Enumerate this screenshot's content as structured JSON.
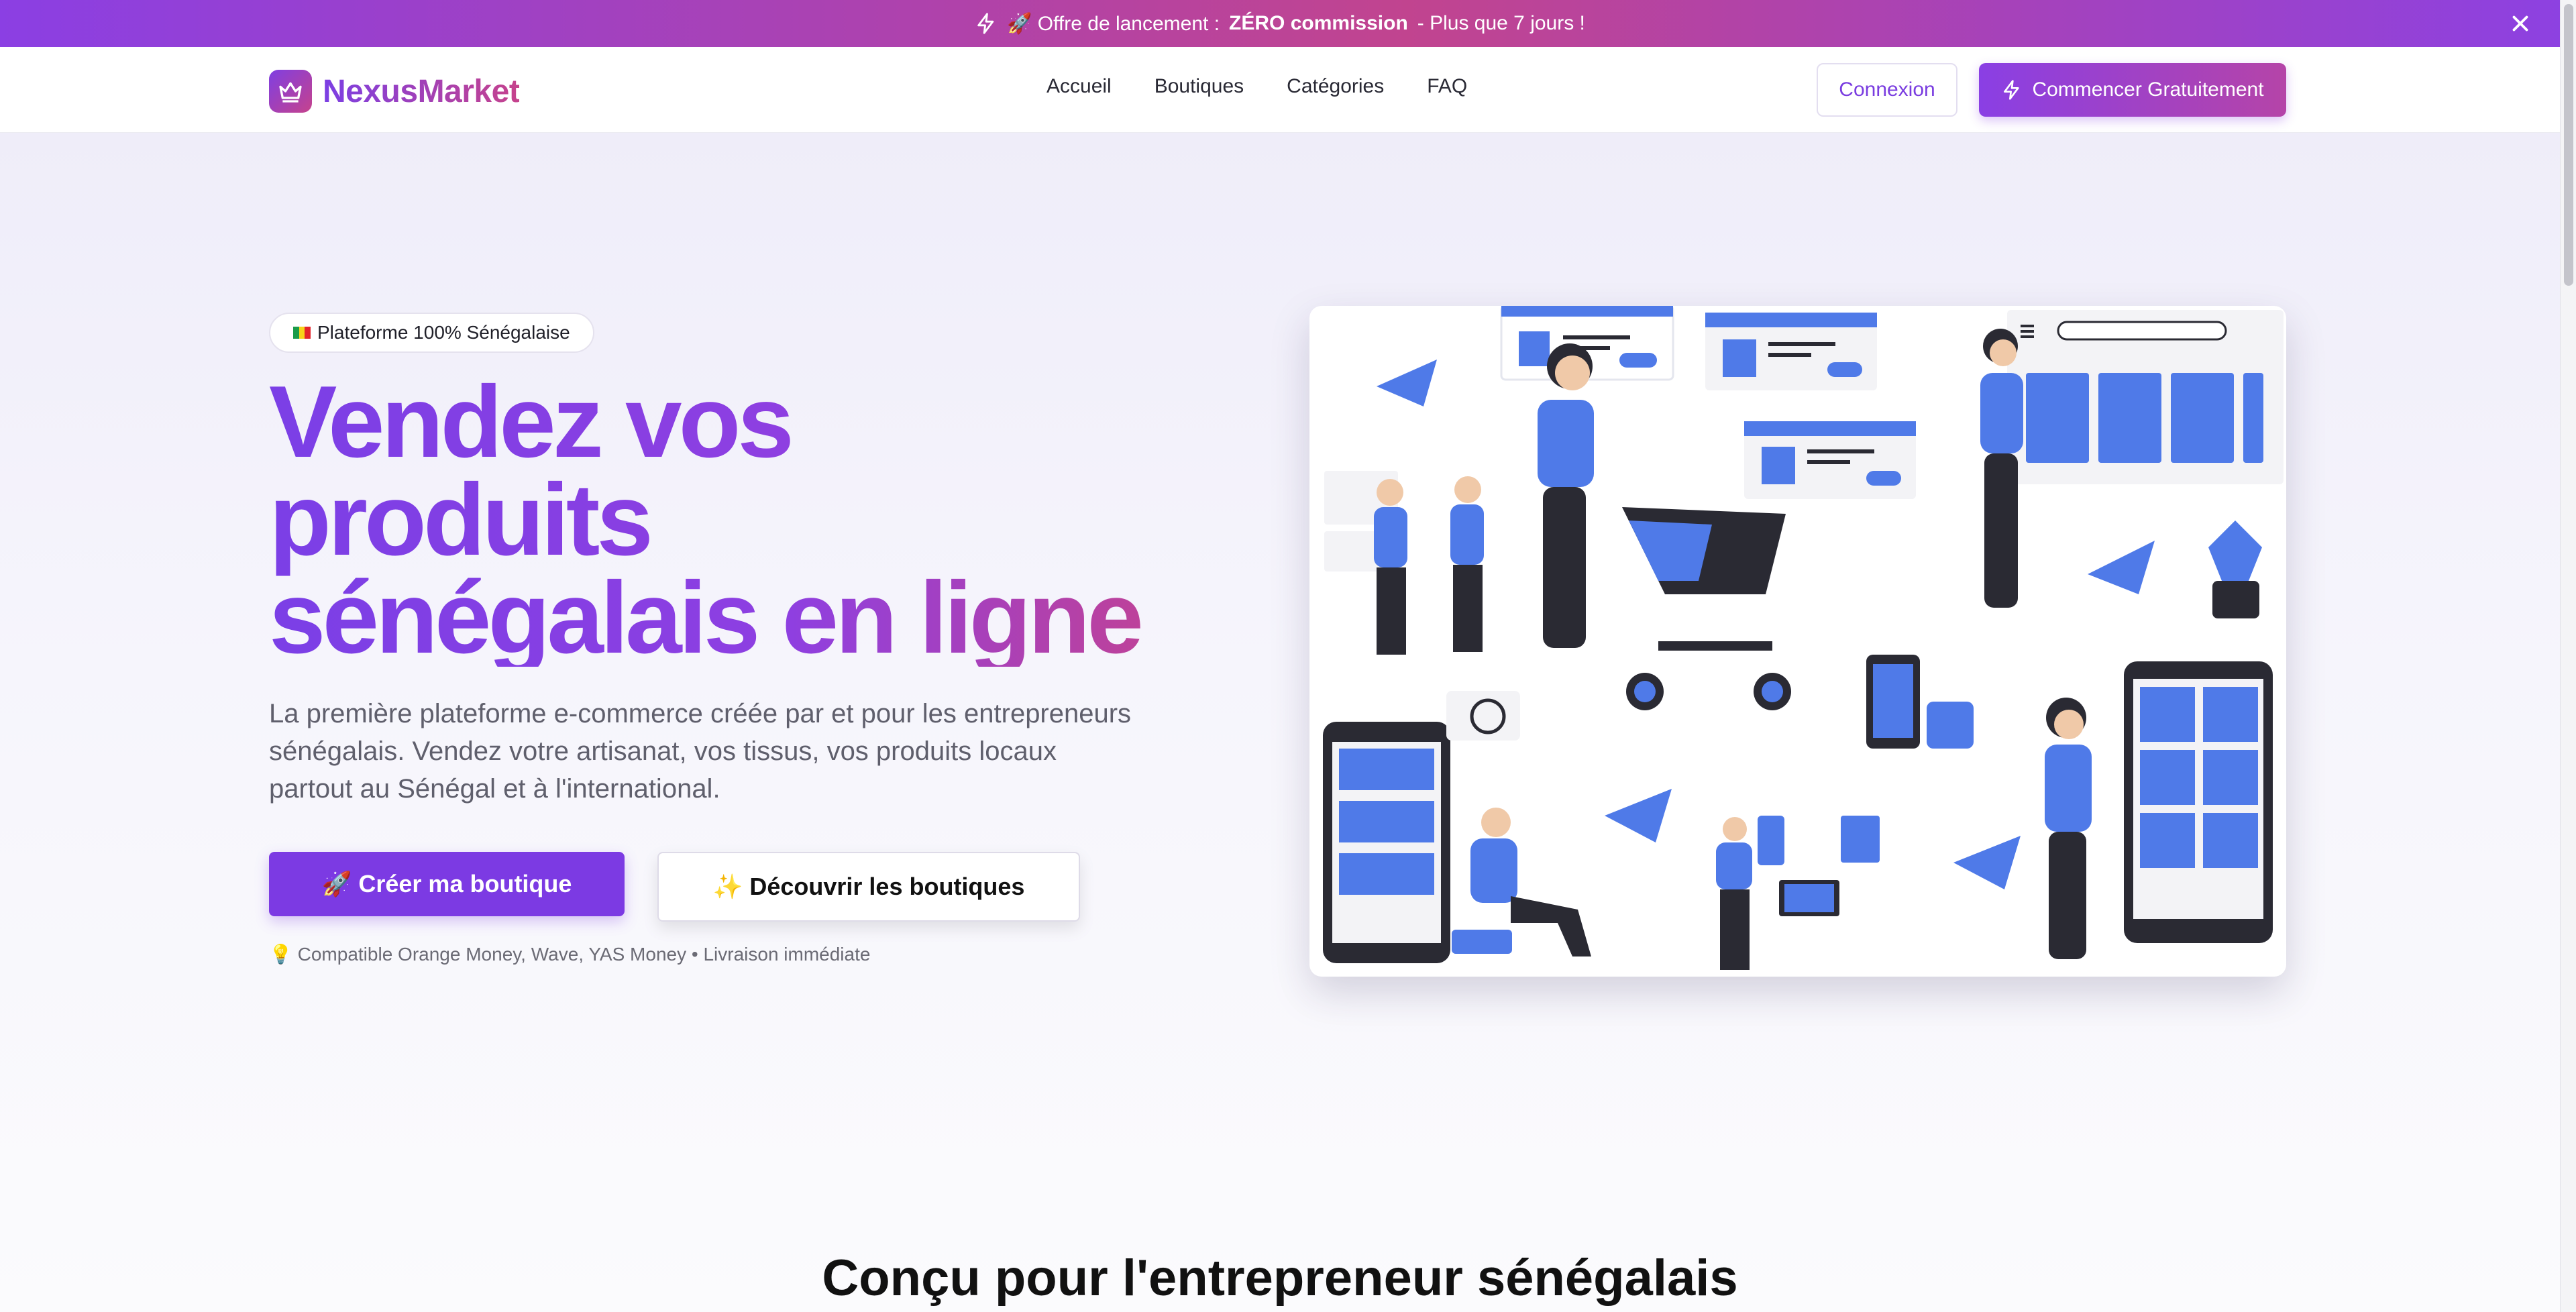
{
  "announcement": {
    "prefix": "🚀 Offre de lancement :",
    "highlight": "ZÉRO commission",
    "suffix": "- Plus que 7 jours !"
  },
  "nav": {
    "brand": "NexusMarket",
    "links": [
      "Accueil",
      "Boutiques",
      "Catégories",
      "FAQ"
    ],
    "login_label": "Connexion",
    "start_label": "Commencer Gratuitement"
  },
  "hero": {
    "badge": "Plateforme 100% Sénégalaise",
    "headline_lines": [
      "Vendez vos",
      "produits",
      "sénégalais en ligne"
    ],
    "subtitle": "La première plateforme e-commerce créée par et pour les entrepreneurs sénégalais. Vendez votre artisanat, vos tissus, vos produits locaux partout au Sénégal et à l'international.",
    "cta_primary": "🚀 Créer ma boutique",
    "cta_secondary": "✨ Découvrir les boutiques",
    "note": "💡 Compatible Orange Money, Wave, YAS Money • Livraison immédiate"
  },
  "section": {
    "title": "Conçu pour l'entrepreneur sénégalais"
  },
  "colors": {
    "primary": "#7c3ae3",
    "secondary": "#c6428c",
    "illustration_blue": "#4f7ae8"
  }
}
